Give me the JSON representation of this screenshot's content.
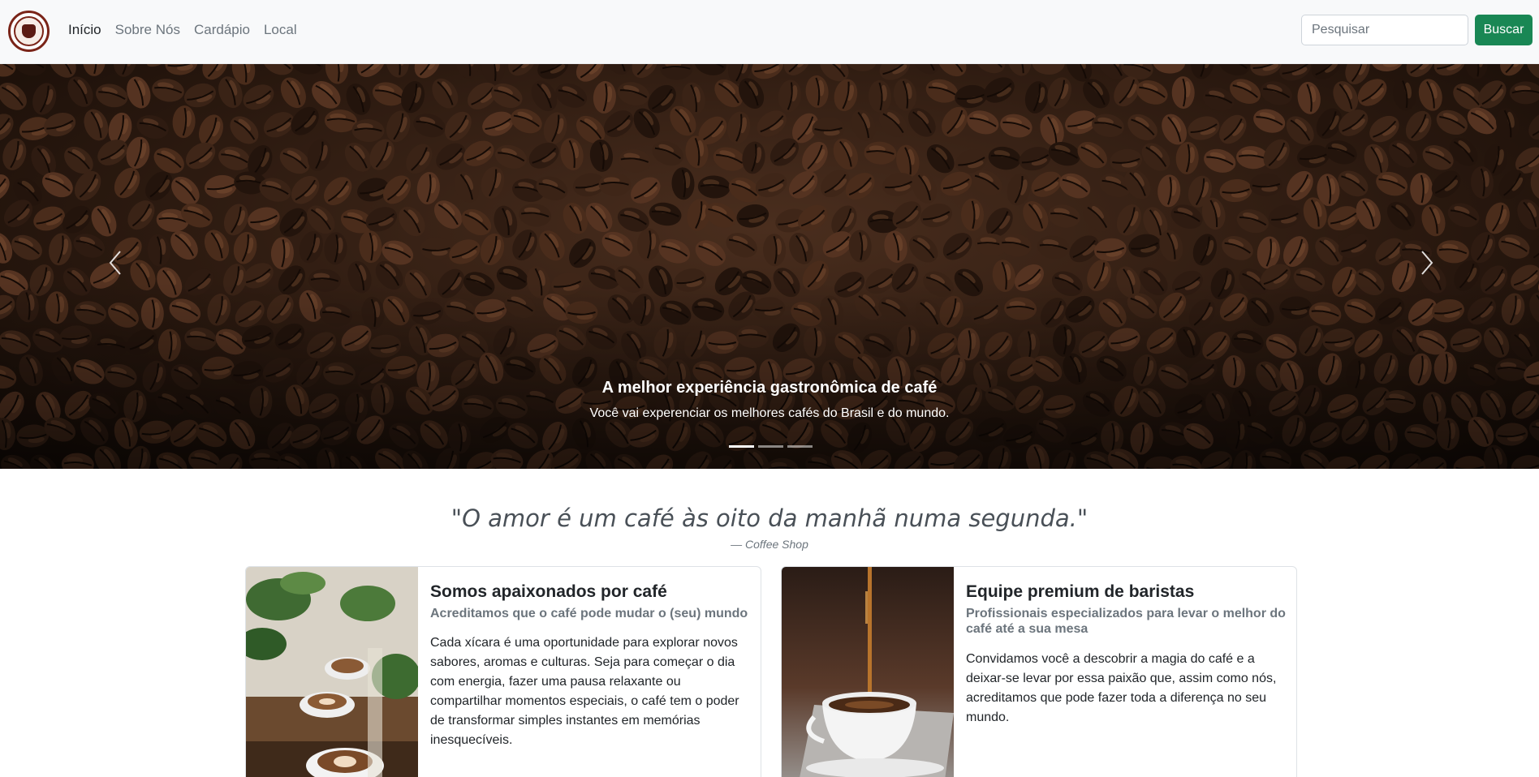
{
  "navbar": {
    "logo_alt": "Coffee Shop logo",
    "links": [
      "Início",
      "Sobre Nós",
      "Cardápio",
      "Local"
    ],
    "active_link": "Início",
    "search": {
      "placeholder": "Pesquisar",
      "value": ""
    },
    "search_button": "Buscar"
  },
  "hero": {
    "title": "A melhor experiência gastronômica de café",
    "subtitle": "Você vai experenciar os melhores cafés do Brasil e do mundo.",
    "slides": 3,
    "active_slide": 1
  },
  "quote": {
    "text": "\"O amor é um café às oito da manhã numa segunda.\"",
    "author": "— Coffee Shop"
  },
  "cards": [
    {
      "title": "Somos apaixonados por café",
      "subtitle": "Acreditamos que o café pode mudar o (seu) mundo",
      "text": "Cada xícara é uma oportunidade para explorar novos sabores, aromas e culturas. Seja para começar o dia com energia, fazer uma pausa relaxante ou compartilhar momentos especiais, o café tem o poder de transformar simples instantes em memórias inesquecíveis."
    },
    {
      "title": "Equipe premium de baristas",
      "subtitle": "Profissionais especializados para levar o melhor do café até a sua mesa",
      "text": "Convidamos você a descobrir a magia do café e a deixar-se levar por essa paixão que, assim como nós, acreditamos que pode fazer toda a diferença no seu mundo."
    }
  ],
  "colors": {
    "navbar_bg": "#f8f9fa",
    "button_success": "#198754",
    "coffee_dark": "#2c1a10",
    "logo_red": "#7a2418"
  }
}
